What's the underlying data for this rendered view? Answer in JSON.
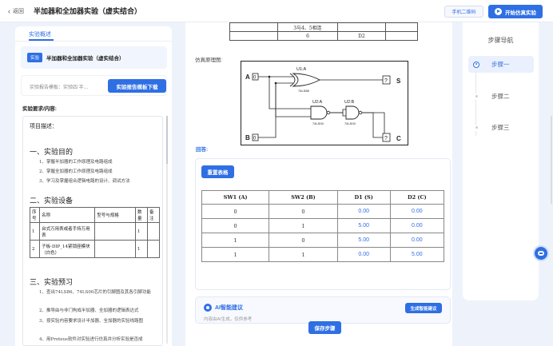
{
  "header": {
    "back_label": "返回",
    "title": "半加器和全加器实验（虚实结合）",
    "qr_button": "手机二维码",
    "start_button": "开始仿真实验"
  },
  "left": {
    "tab": "实验概述",
    "experiment_tag": "实验",
    "experiment_name": "半加器和全加器实验（虚实结合）",
    "template_label": "实验报告模板：实验四 半…",
    "template_button": "实验报告模板下载",
    "requirements_label": "实验要求/内容:",
    "doc": {
      "intro": "项目描述：",
      "s1_title": "一、实验目的",
      "s1_items": [
        "1、掌握半加器的工作原理及电路组成",
        "2、掌握全加器的工作原理及电路组成",
        "3、学习及掌握组合逻辑电路的设计、调试方法"
      ],
      "s2_title": "二、实验设备",
      "equip_headers": [
        "序号",
        "名称",
        "型号与规格",
        "数量",
        "备注"
      ],
      "equip_rows": [
        [
          "1",
          "台式万用表或者手持万用表",
          "",
          "1",
          ""
        ],
        [
          "2",
          "子板-DIP_14紧锁座模块（白色）",
          "",
          "1",
          ""
        ]
      ],
      "s3_title": "三、实验预习",
      "s3_items": [
        "1、查出74LS86、74LS00芯片的引脚图及其各引脚功能",
        "2、推导由与非门构成半加器、全加器的逻辑表达式",
        "3、按实验内容要求设计半加器、全加器的实验线路图",
        "4、用Proteus软件对实验进行仿真并分析实验是否成"
      ]
    }
  },
  "center": {
    "top_table": [
      [
        "",
        "3与4、5相连",
        "",
        ""
      ],
      [
        "",
        "6",
        "D2",
        ""
      ]
    ],
    "sim_label": "仿真原理图:",
    "circuit": {
      "input_a": "A",
      "input_b": "B",
      "output_s": "S",
      "output_c": "C",
      "u1": "U1:A",
      "u2": "U2:A",
      "u3": "U2:B",
      "u1_part": "74LS86",
      "u2_part": "74LS00",
      "u3_part": "74LS00",
      "probe": "?"
    },
    "answer_label": "回答:",
    "reset_button": "重置表格",
    "result_headers": [
      "SW1 (A)",
      "SW2 (B)",
      "D1 (S)",
      "D2 (C)"
    ],
    "result_rows": [
      [
        "0",
        "0",
        "0.00",
        "0.00"
      ],
      [
        "0",
        "1",
        "5.00",
        "0.00"
      ],
      [
        "1",
        "0",
        "5.00",
        "0.00"
      ],
      [
        "1",
        "1",
        "0.00",
        "5.00"
      ]
    ],
    "ai_title": "AI智能建议",
    "ai_sub": "内容由AI生成，仅供参考",
    "ai_button": "生成智能建议",
    "save_button": "保存步骤"
  },
  "right": {
    "nav_title": "步骤导航",
    "steps": [
      "步骤一",
      "步骤二",
      "步骤三"
    ]
  },
  "colors": {
    "accent": "#2f6fe4",
    "background": "#eef3fb"
  }
}
